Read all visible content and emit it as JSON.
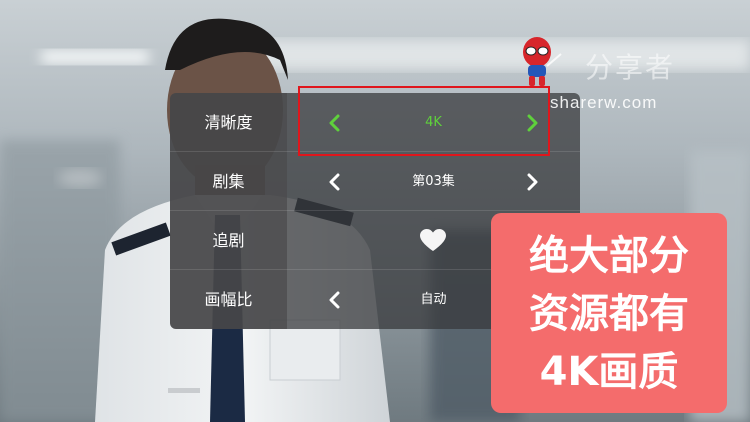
{
  "settings": {
    "rows": [
      {
        "label": "清晰度",
        "value": "4K"
      },
      {
        "label": "剧集",
        "value": "第03集"
      },
      {
        "label": "追剧"
      },
      {
        "label": "画幅比",
        "value": "自动"
      }
    ]
  },
  "icons": {
    "prev": "chevron-left-icon",
    "next": "chevron-right-icon",
    "favorite": "heart-icon"
  },
  "colors": {
    "active": "#5fd13c",
    "highlight": "#e0161c",
    "promo_bg": "#f46c6c"
  },
  "watermark": {
    "title": "分享者",
    "url": "sharerw.com"
  },
  "promo": {
    "lines": [
      "绝大部分",
      "资源都有",
      "4K画质"
    ]
  }
}
